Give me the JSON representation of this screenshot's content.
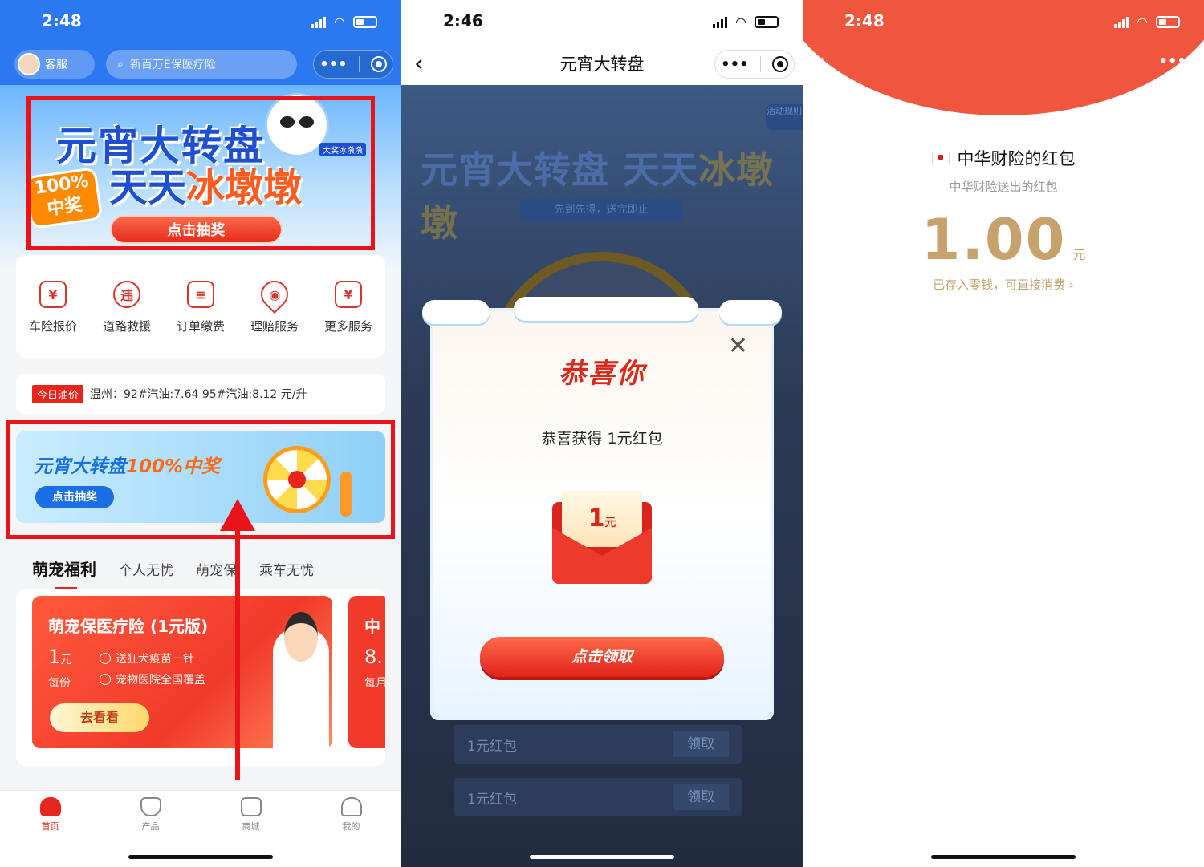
{
  "screen1": {
    "status_time": "2:48",
    "customer_service": "客服",
    "search_placeholder": "新百万E保医疗险",
    "hero": {
      "title_line1": "元宵大转盘",
      "title_line2_a": "天天",
      "title_line2_b": "冰墩墩",
      "tag": "大奖冰墩墩",
      "badge_line1": "100%",
      "badge_line2": "中奖",
      "button": "点击抽奖"
    },
    "services": [
      {
        "label": "车险报价",
        "icon": "car-insurance-icon",
        "glyph": "¥"
      },
      {
        "label": "道路救援",
        "icon": "road-rescue-icon",
        "glyph": "违"
      },
      {
        "label": "订单缴费",
        "icon": "order-payment-icon",
        "glyph": "≡"
      },
      {
        "label": "理赔服务",
        "icon": "claim-location-icon",
        "glyph": "◉"
      },
      {
        "label": "更多服务",
        "icon": "more-services-icon",
        "glyph": "¥"
      }
    ],
    "oil": {
      "tag": "今日油价",
      "text": "温州：92#汽油:7.64   95#汽油:8.12   元/升"
    },
    "promo": {
      "title_a": "元宵大转盘",
      "title_b": "100%中奖",
      "button": "点击抽奖"
    },
    "tabs": [
      "萌宠福利",
      "个人无忧",
      "萌宠保",
      "乘车无忧"
    ],
    "product": {
      "title": "萌宠保医疗险 (1元版)",
      "price": "1",
      "price_unit": "元",
      "per": "每份",
      "features": [
        "送狂犬疫苗一针",
        "宠物医院全国覆盖"
      ],
      "button": "去看看"
    },
    "product2": {
      "title": "中",
      "price": "8.",
      "per": "每月"
    },
    "bottom_nav": [
      "首页",
      "产品",
      "商城",
      "我的"
    ],
    "colors": {
      "brand_blue": "#2b78f0",
      "highlight_red": "#e8141a"
    }
  },
  "screen2": {
    "status_time": "2:46",
    "title": "元宵大转盘",
    "game_title_a": "元宵大转盘 天天",
    "game_title_b": "冰墩墩",
    "game_sub": "先到先得，送完即止",
    "rules": "活动规则",
    "modal": {
      "title": "恭喜你",
      "message": "恭喜获得 1元红包",
      "envelope_amount": "1",
      "envelope_unit": "元",
      "button": "点击领取"
    },
    "prizes": [
      {
        "name": "1元红包",
        "action": "领取"
      },
      {
        "name": "1元红包",
        "action": "领取"
      }
    ]
  },
  "screen3": {
    "status_time": "2:48",
    "title": "中华财险的红包",
    "subtitle": "中华财险送出的红包",
    "amount": "1.00",
    "unit": "元",
    "note": "已存入零钱，可直接消费 ›",
    "colors": {
      "header": "#f0553e",
      "gold": "#c7a26d"
    }
  }
}
